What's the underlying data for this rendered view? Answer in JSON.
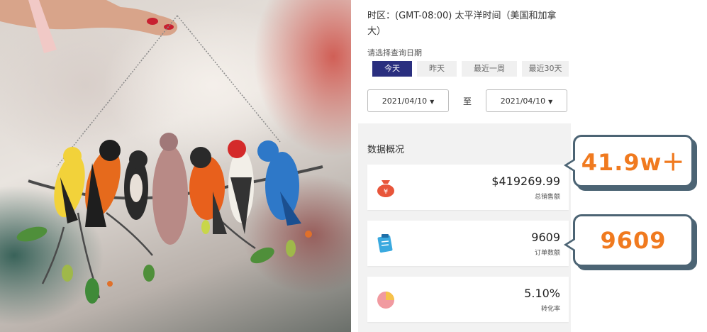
{
  "timezone": {
    "text": "时区：(GMT-08:00) 太平洋时间（美国和加拿大）"
  },
  "date_picker": {
    "label": "请选择查询日期",
    "ranges": [
      {
        "label": "今天",
        "active": true
      },
      {
        "label": "昨天",
        "active": false
      },
      {
        "label": "最近一周",
        "active": false
      },
      {
        "label": "最近30天",
        "active": false
      }
    ],
    "start_date": "2021/04/10",
    "separator": "至",
    "end_date": "2021/04/10"
  },
  "overview": {
    "title": "数据概况",
    "cards": [
      {
        "value": "$419269.99",
        "label": "总销售额",
        "icon": "money-bag-icon"
      },
      {
        "value": "9609",
        "label": "订单数额",
        "icon": "clipboard-icon"
      },
      {
        "value": "5.10%",
        "label": "转化率",
        "icon": "pie-chart-icon"
      }
    ]
  },
  "callouts": [
    {
      "text": "41.9w＋"
    },
    {
      "text": "9609"
    }
  ],
  "colors": {
    "accent": "#2a2f7f",
    "callout_text": "#f07a1f",
    "callout_border": "#4c6474"
  }
}
